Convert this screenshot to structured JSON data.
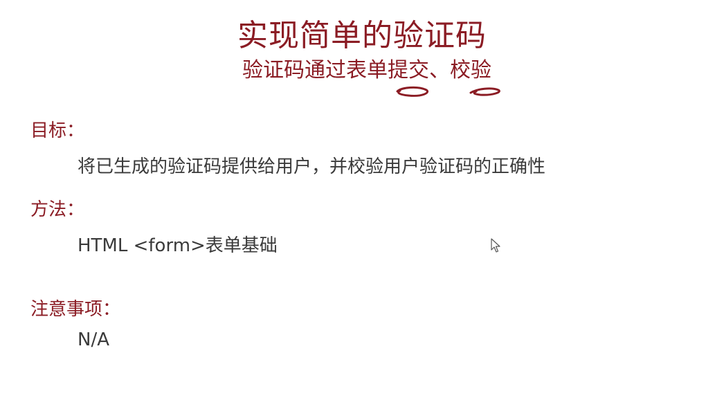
{
  "slide": {
    "title": "实现简单的验证码",
    "subtitle": "验证码通过表单提交、校验"
  },
  "sections": [
    {
      "heading": "目标：",
      "body": "将已生成的验证码提供给用户，并校验用户验证码的正确性"
    },
    {
      "heading": "方法：",
      "body": "HTML <form>表单基础"
    },
    {
      "heading": "注意事项：",
      "body": "N/A"
    }
  ],
  "colors": {
    "accent": "#8b1c24",
    "body_text": "#3a3a3a",
    "background": "#ffffff"
  },
  "icons": {
    "cursor": "mouse-pointer-icon",
    "annotation": "pen-scribble"
  }
}
